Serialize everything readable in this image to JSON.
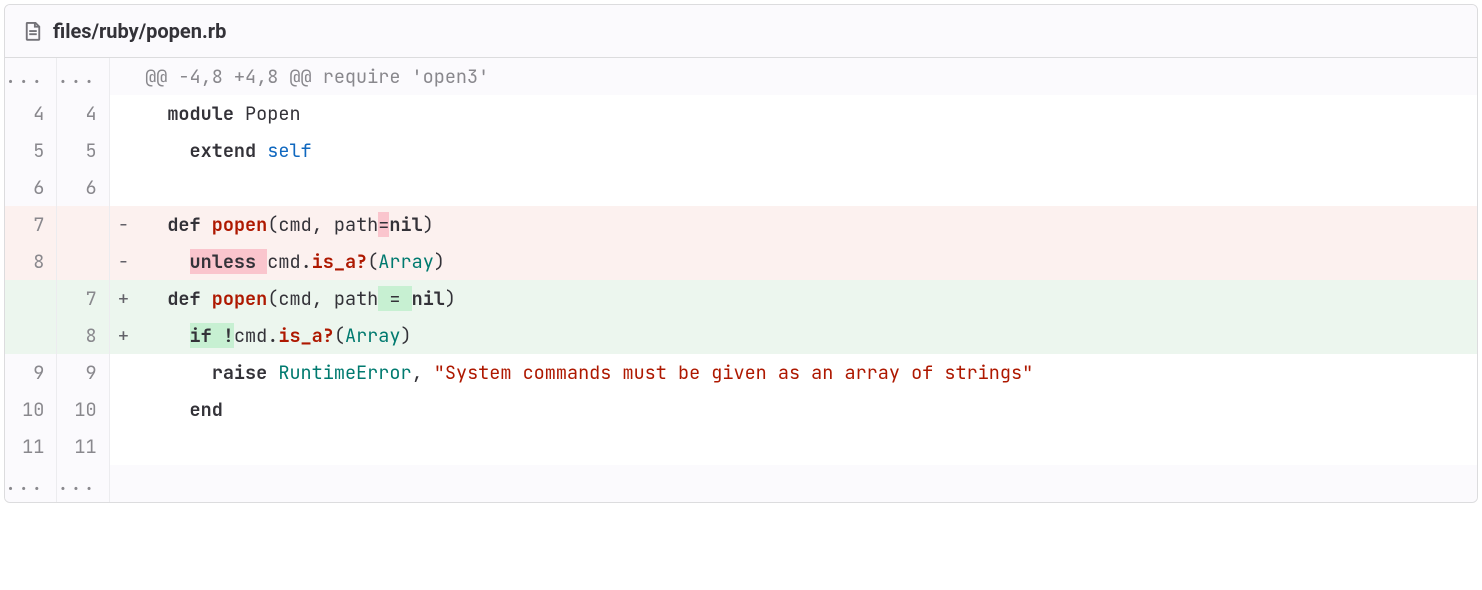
{
  "file": {
    "path": "files/ruby/popen.rb"
  },
  "hunk_header": "@@ -4,8 +4,8 @@ require 'open3'",
  "lines": {
    "l4": {
      "old": "4",
      "new": "4",
      "kw": "module",
      "name": " Popen"
    },
    "l5": {
      "old": "5",
      "new": "5",
      "kw": "extend",
      "self": "self"
    },
    "l6": {
      "old": "6",
      "new": "6"
    },
    "r7": {
      "old": "7",
      "sign": "-",
      "def": "def",
      "fn": "popen",
      "args_a": "(cmd, path",
      "eq": "=",
      "args_b": "nil",
      "close": ")"
    },
    "r8": {
      "old": "8",
      "sign": "-",
      "kw": "unless",
      "sp": " ",
      "obj": "cmd",
      "dot": ".",
      "meth": "is_a?",
      "open": "(",
      "cls": "Array",
      "close": ")"
    },
    "a7": {
      "new": "7",
      "sign": "+",
      "def": "def",
      "fn": "popen",
      "args_a": "(cmd, path",
      "eq": " = ",
      "args_b": "nil",
      "close": ")"
    },
    "a8": {
      "new": "8",
      "sign": "+",
      "kw": "if !",
      "obj": "cmd",
      "dot": ".",
      "meth": "is_a?",
      "open": "(",
      "cls": "Array",
      "close": ")"
    },
    "l9": {
      "old": "9",
      "new": "9",
      "kw": "raise",
      "cls": "RuntimeError",
      "comma": ", ",
      "str": "\"System commands must be given as an array of strings\""
    },
    "l10": {
      "old": "10",
      "new": "10",
      "kw": "end"
    },
    "l11": {
      "old": "11",
      "new": "11"
    }
  },
  "expand": "..."
}
